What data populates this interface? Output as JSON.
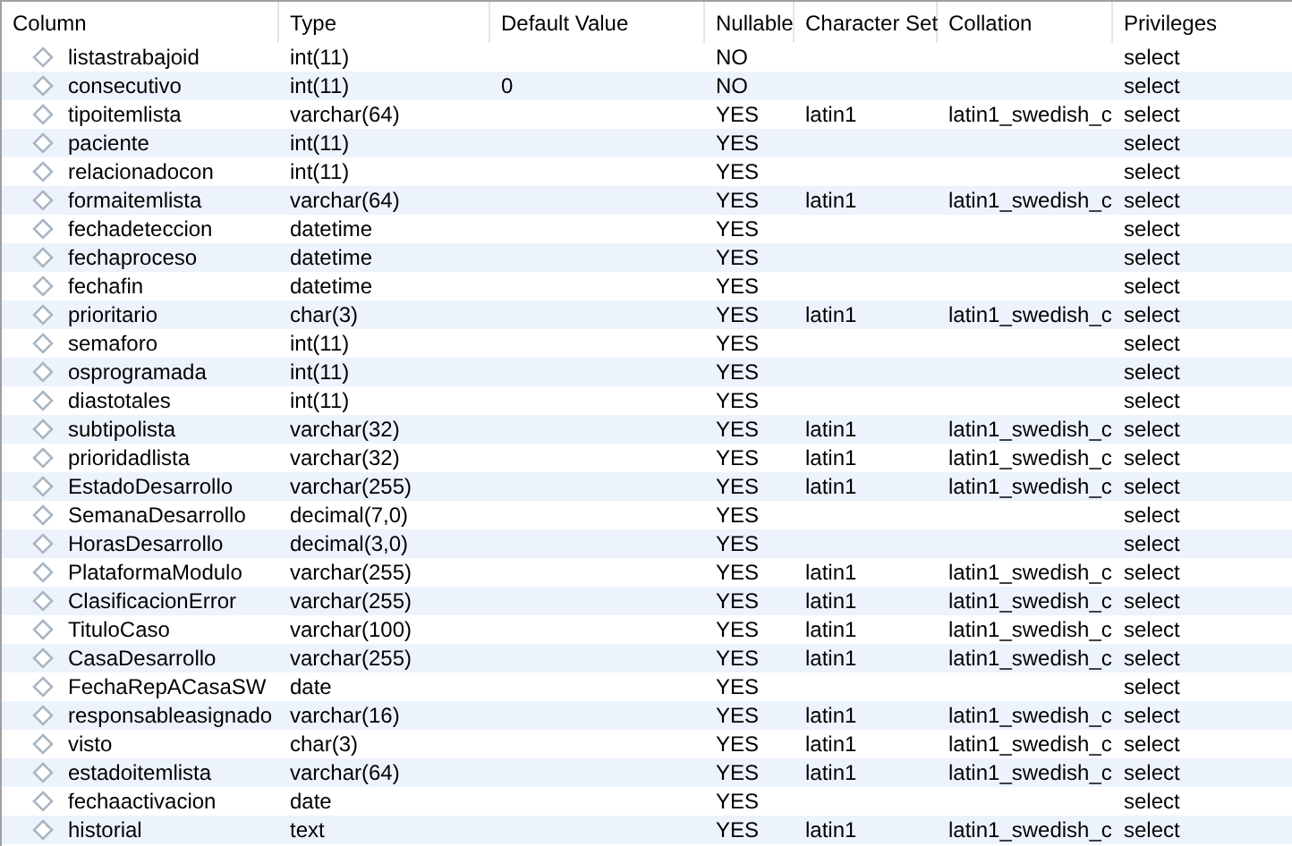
{
  "table": {
    "columns": [
      "Column",
      "Type",
      "Default Value",
      "Nullable",
      "Character Set",
      "Collation",
      "Privileges"
    ],
    "rows": [
      {
        "cells": [
          "listastrabajoid",
          "int(11)",
          "",
          "NO",
          "",
          "",
          "select"
        ]
      },
      {
        "cells": [
          "consecutivo",
          "int(11)",
          "0",
          "NO",
          "",
          "",
          "select"
        ]
      },
      {
        "cells": [
          "tipoitemlista",
          "varchar(64)",
          "",
          "YES",
          "latin1",
          "latin1_swedish_c",
          "select"
        ]
      },
      {
        "cells": [
          "paciente",
          "int(11)",
          "",
          "YES",
          "",
          "",
          "select"
        ]
      },
      {
        "cells": [
          "relacionadocon",
          "int(11)",
          "",
          "YES",
          "",
          "",
          "select"
        ]
      },
      {
        "cells": [
          "formaitemlista",
          "varchar(64)",
          "",
          "YES",
          "latin1",
          "latin1_swedish_c",
          "select"
        ]
      },
      {
        "cells": [
          "fechadeteccion",
          "datetime",
          "",
          "YES",
          "",
          "",
          "select"
        ]
      },
      {
        "cells": [
          "fechaproceso",
          "datetime",
          "",
          "YES",
          "",
          "",
          "select"
        ]
      },
      {
        "cells": [
          "fechafin",
          "datetime",
          "",
          "YES",
          "",
          "",
          "select"
        ]
      },
      {
        "cells": [
          "prioritario",
          "char(3)",
          "",
          "YES",
          "latin1",
          "latin1_swedish_c",
          "select"
        ]
      },
      {
        "cells": [
          "semaforo",
          "int(11)",
          "",
          "YES",
          "",
          "",
          "select"
        ]
      },
      {
        "cells": [
          "osprogramada",
          "int(11)",
          "",
          "YES",
          "",
          "",
          "select"
        ]
      },
      {
        "cells": [
          "diastotales",
          "int(11)",
          "",
          "YES",
          "",
          "",
          "select"
        ]
      },
      {
        "cells": [
          "subtipolista",
          "varchar(32)",
          "",
          "YES",
          "latin1",
          "latin1_swedish_c",
          "select"
        ]
      },
      {
        "cells": [
          "prioridadlista",
          "varchar(32)",
          "",
          "YES",
          "latin1",
          "latin1_swedish_c",
          "select"
        ]
      },
      {
        "cells": [
          "EstadoDesarrollo",
          "varchar(255)",
          "",
          "YES",
          "latin1",
          "latin1_swedish_c",
          "select"
        ]
      },
      {
        "cells": [
          "SemanaDesarrollo",
          "decimal(7,0)",
          "",
          "YES",
          "",
          "",
          "select"
        ]
      },
      {
        "cells": [
          "HorasDesarrollo",
          "decimal(3,0)",
          "",
          "YES",
          "",
          "",
          "select"
        ]
      },
      {
        "cells": [
          "PlataformaModulo",
          "varchar(255)",
          "",
          "YES",
          "latin1",
          "latin1_swedish_c",
          "select"
        ]
      },
      {
        "cells": [
          "ClasificacionError",
          "varchar(255)",
          "",
          "YES",
          "latin1",
          "latin1_swedish_c",
          "select"
        ]
      },
      {
        "cells": [
          "TituloCaso",
          "varchar(100)",
          "",
          "YES",
          "latin1",
          "latin1_swedish_c",
          "select"
        ]
      },
      {
        "cells": [
          "CasaDesarrollo",
          "varchar(255)",
          "",
          "YES",
          "latin1",
          "latin1_swedish_c",
          "select"
        ]
      },
      {
        "cells": [
          "FechaRepACasaSW",
          "date",
          "",
          "YES",
          "",
          "",
          "select"
        ]
      },
      {
        "cells": [
          "responsableasignado",
          "varchar(16)",
          "",
          "YES",
          "latin1",
          "latin1_swedish_c",
          "select"
        ]
      },
      {
        "cells": [
          "visto",
          "char(3)",
          "",
          "YES",
          "latin1",
          "latin1_swedish_c",
          "select"
        ]
      },
      {
        "cells": [
          "estadoitemlista",
          "varchar(64)",
          "",
          "YES",
          "latin1",
          "latin1_swedish_c",
          "select"
        ]
      },
      {
        "cells": [
          "fechaactivacion",
          "date",
          "",
          "YES",
          "",
          "",
          "select"
        ]
      },
      {
        "cells": [
          "historial",
          "text",
          "",
          "YES",
          "latin1",
          "latin1_swedish_c",
          "select"
        ]
      }
    ]
  }
}
